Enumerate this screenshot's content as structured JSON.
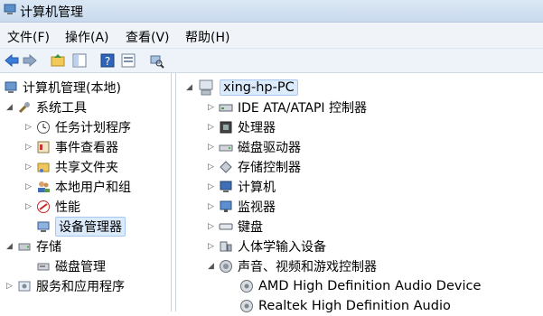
{
  "window": {
    "title": "计算机管理"
  },
  "menu": [
    {
      "label": "文件(F)"
    },
    {
      "label": "操作(A)"
    },
    {
      "label": "查看(V)"
    },
    {
      "label": "帮助(H)"
    }
  ],
  "toolbar": {
    "icons": [
      "back-icon",
      "forward-icon",
      "up-folder-icon",
      "show-hide-tree-icon",
      "help-icon",
      "properties-icon",
      "scan-hardware-icon"
    ]
  },
  "tree": {
    "root": "计算机管理(本地)",
    "system_tools": "系统工具",
    "task_scheduler": "任务计划程序",
    "event_viewer": "事件查看器",
    "shared_folders": "共享文件夹",
    "local_users": "本地用户和组",
    "performance": "性能",
    "device_manager": "设备管理器",
    "storage": "存储",
    "disk_management": "磁盘管理",
    "services_apps": "服务和应用程序"
  },
  "devices": {
    "computer_name": "xing-hp-PC",
    "categories": [
      {
        "label": "IDE ATA/ATAPI 控制器"
      },
      {
        "label": "处理器"
      },
      {
        "label": "磁盘驱动器"
      },
      {
        "label": "存储控制器"
      },
      {
        "label": "计算机"
      },
      {
        "label": "监视器"
      },
      {
        "label": "键盘"
      },
      {
        "label": "人体学输入设备"
      },
      {
        "label": "声音、视频和游戏控制器"
      }
    ],
    "sound_devices": [
      {
        "label": "AMD High Definition Audio Device"
      },
      {
        "label": "Realtek High Definition Audio"
      }
    ]
  },
  "colors": {
    "selection": "#dcebfc",
    "titlebar": "#c9daee"
  }
}
